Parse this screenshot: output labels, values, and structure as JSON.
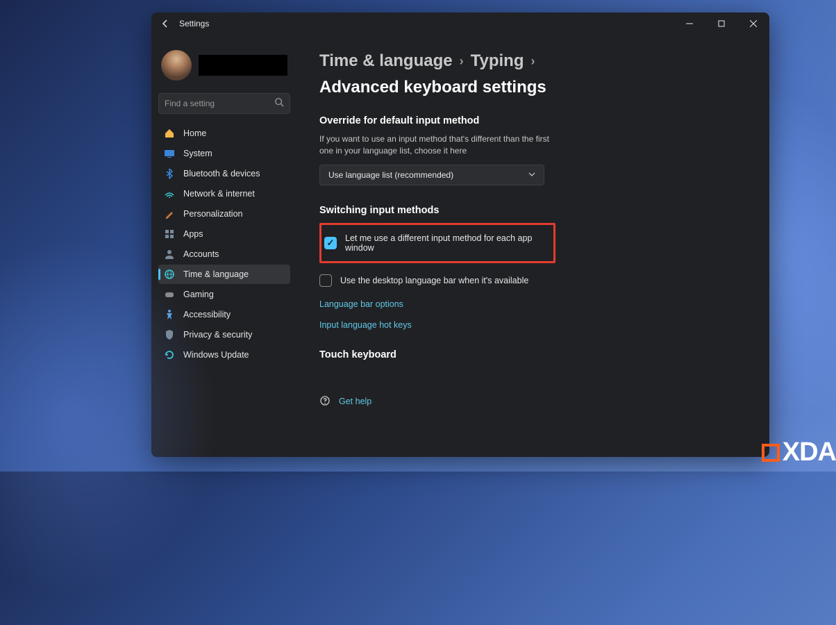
{
  "window": {
    "title": "Settings"
  },
  "search": {
    "placeholder": "Find a setting"
  },
  "sidebar": {
    "items": [
      {
        "label": "Home",
        "icon": "home",
        "color": "#f2b84b"
      },
      {
        "label": "System",
        "icon": "system",
        "color": "#3a86d8"
      },
      {
        "label": "Bluetooth & devices",
        "icon": "bluetooth",
        "color": "#3a86d8"
      },
      {
        "label": "Network & internet",
        "icon": "network",
        "color": "#3ac8d8"
      },
      {
        "label": "Personalization",
        "icon": "personalization",
        "color": "#c57338"
      },
      {
        "label": "Apps",
        "icon": "apps",
        "color": "#7a8a9a"
      },
      {
        "label": "Accounts",
        "icon": "accounts",
        "color": "#7a8a9a"
      },
      {
        "label": "Time & language",
        "icon": "time-language",
        "color": "#3ac8d8",
        "active": true
      },
      {
        "label": "Gaming",
        "icon": "gaming",
        "color": "#8a8a8a"
      },
      {
        "label": "Accessibility",
        "icon": "accessibility",
        "color": "#5aa0e0"
      },
      {
        "label": "Privacy & security",
        "icon": "privacy",
        "color": "#7a8a9a"
      },
      {
        "label": "Windows Update",
        "icon": "windows-update",
        "color": "#3ac8d8"
      }
    ]
  },
  "breadcrumb": {
    "level1": "Time & language",
    "level2": "Typing",
    "level3": "Advanced keyboard settings"
  },
  "sections": {
    "override": {
      "title": "Override for default input method",
      "desc": "If you want to use an input method that's different than the first one in your language list, choose it here",
      "dropdown_value": "Use language list (recommended)"
    },
    "switching": {
      "title": "Switching input methods",
      "checkbox1": "Let me use a different input method for each app window",
      "checkbox2": "Use the desktop language bar when it's available",
      "link1": "Language bar options",
      "link2": "Input language hot keys"
    },
    "touch": {
      "title": "Touch keyboard"
    },
    "help": {
      "label": "Get help"
    }
  },
  "watermark": "XDA"
}
